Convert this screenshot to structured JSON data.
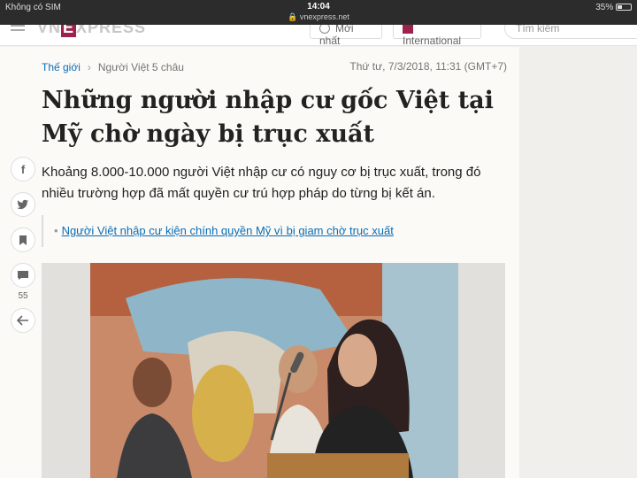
{
  "status_bar": {
    "carrier": "Không có SIM",
    "time": "14:04",
    "url": "vnexpress.net",
    "battery": "35%",
    "battery_level": 0.35
  },
  "nav": {
    "logo_prefix": "VN",
    "logo_e": "E",
    "logo_suffix": "XPRESS",
    "latest": "Mới nhất",
    "international": "International",
    "search_placeholder": "Tìm kiếm"
  },
  "breadcrumb": {
    "category": "Thế giới",
    "subcategory": "Người Việt 5 châu",
    "date": "Thứ tư, 7/3/2018, 11:31 (GMT+7)"
  },
  "article": {
    "title": "Những người nhập cư gốc Việt tại Mỹ chờ ngày bị trục xuất",
    "lead": "Khoảng 8.000-10.000 người Việt nhập cư có nguy cơ bị trục xuất, trong đó nhiều trường hợp đã mất quyền cư trú hợp pháp do từng bị kết án.",
    "related_link": "Người Việt nhập cư kiện chính quyền Mỹ vì bị giam chờ trục xuất"
  },
  "social": {
    "facebook": "f",
    "twitter": "t",
    "comments_count": "55",
    "icons": [
      "facebook-icon",
      "twitter-icon",
      "bookmark-icon",
      "comment-icon",
      "back-arrow-icon"
    ]
  },
  "colors": {
    "brand": "#9f224e",
    "link": "#076db6"
  }
}
